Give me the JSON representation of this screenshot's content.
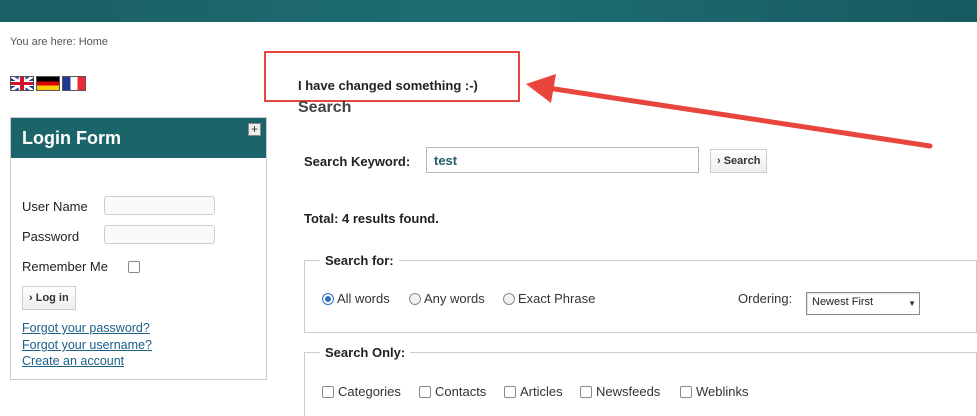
{
  "breadcrumb": "You are here: Home",
  "languages": [
    "uk-flag-icon",
    "german-flag-icon",
    "french-flag-icon"
  ],
  "annotation": {
    "text": "I have changed something :-)",
    "color": "#e8453c"
  },
  "login": {
    "title": "Login Form",
    "expand_label": "+",
    "username_label": "User Name",
    "password_label": "Password",
    "remember_label": "Remember Me",
    "login_button": "› Log in",
    "forgot_password": "Forgot your password?",
    "forgot_username": "Forgot your username?",
    "create_account": "Create an account"
  },
  "search": {
    "heading": "Search",
    "keyword_label": "Search Keyword:",
    "keyword_value": "test",
    "search_button": "› Search",
    "total": "Total: 4 results found.",
    "search_for_legend": "Search for:",
    "modes": [
      "All words",
      "Any words",
      "Exact Phrase"
    ],
    "selected_mode": "All words",
    "ordering_label": "Ordering:",
    "ordering_value": "Newest First",
    "search_only_legend": "Search Only:",
    "areas": [
      "Categories",
      "Contacts",
      "Articles",
      "Newsfeeds",
      "Weblinks"
    ]
  },
  "colors": {
    "header_teal": "#1b6469",
    "link_blue": "#1b5f87",
    "radio_blue": "#2d6fb8"
  }
}
